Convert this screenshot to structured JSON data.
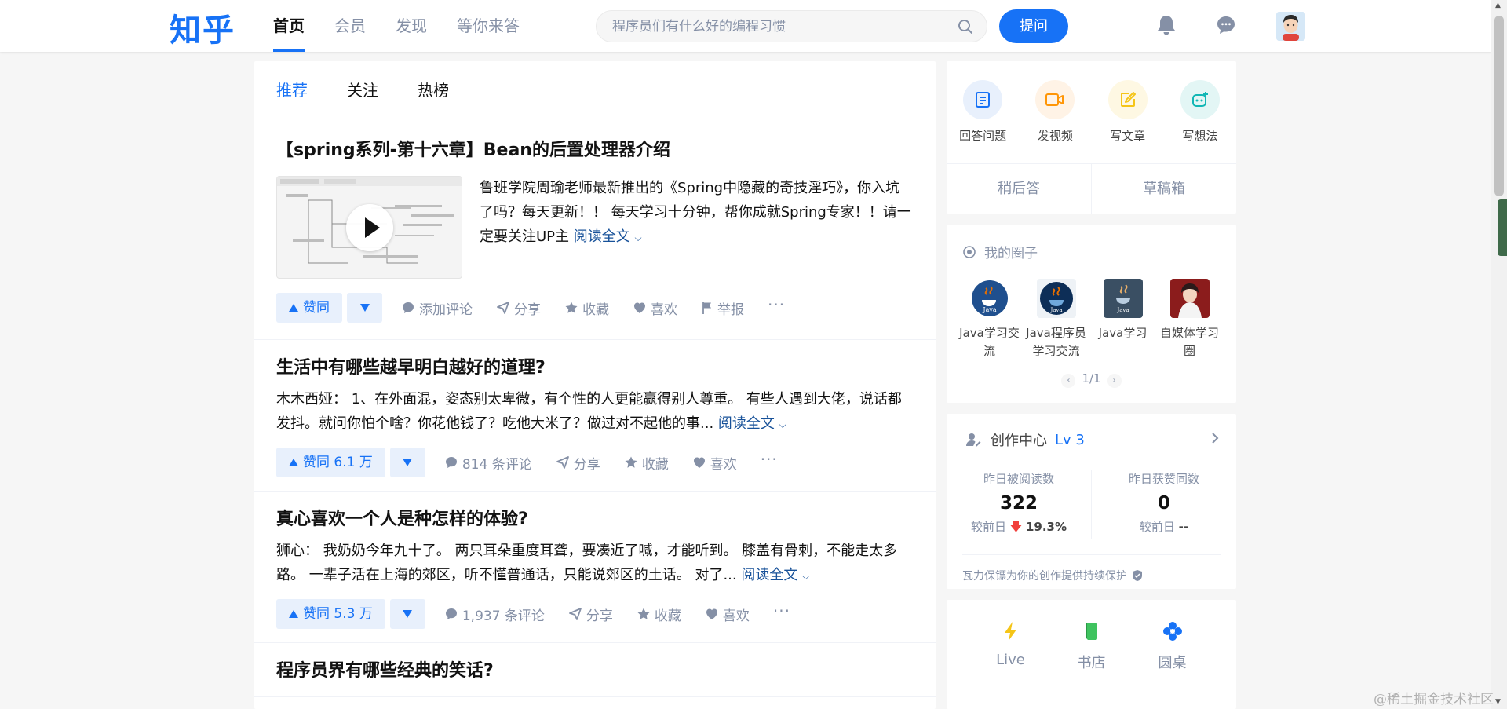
{
  "header": {
    "logo": "知乎",
    "nav": [
      {
        "label": "首页",
        "active": true
      },
      {
        "label": "会员",
        "active": false
      },
      {
        "label": "发现",
        "active": false
      },
      {
        "label": "等你来答",
        "active": false
      }
    ],
    "search_placeholder": "程序员们有什么好的编程习惯",
    "ask_label": "提问"
  },
  "feed": {
    "tabs": [
      {
        "label": "推荐",
        "active": true
      },
      {
        "label": "关注",
        "active": false
      },
      {
        "label": "热榜",
        "active": false
      }
    ],
    "cards": [
      {
        "title": "【spring系列-第十六章】Bean的后置处理器介绍",
        "excerpt": "鲁班学院周瑜老师最新推出的《Spring中隐藏的奇技淫巧》，你入坑了吗？每天更新！！ 每天学习十分钟，帮你成就Spring专家！！请一定要关注UP主",
        "read_more": "阅读全文",
        "vote_label": "赞同",
        "comments": "添加评论",
        "share": "分享",
        "collect": "收藏",
        "like": "喜欢",
        "report": "举报",
        "more": "···"
      },
      {
        "title": "生活中有哪些越早明白越好的道理?",
        "excerpt": "木木西娅： 1、在外面混，姿态别太卑微，有个性的人更能赢得别人尊重。 有些人遇到大佬，说话都发抖。就问你怕个啥？你花他钱了？吃他大米了？做过对不起他的事...",
        "read_more": "阅读全文",
        "vote_label": "赞同 6.1 万",
        "comments": "814 条评论",
        "share": "分享",
        "collect": "收藏",
        "like": "喜欢",
        "more": "···"
      },
      {
        "title": "真心喜欢一个人是种怎样的体验?",
        "excerpt": "狮心： 我奶奶今年九十了。 两只耳朵重度耳聋，要凑近了喊，才能听到。 膝盖有骨刺，不能走太多路。 一辈子活在上海的郊区，听不懂普通话，只能说郊区的土话。 对了...",
        "read_more": "阅读全文",
        "vote_label": "赞同 5.3 万",
        "comments": "1,937 条评论",
        "share": "分享",
        "collect": "收藏",
        "like": "喜欢",
        "more": "···"
      },
      {
        "title": "程序员界有哪些经典的笑话?"
      }
    ]
  },
  "sidebar": {
    "quick": [
      {
        "label": "回答问题",
        "icon": "answer-icon",
        "color": "#1772f6",
        "bg": "#e8f0fc"
      },
      {
        "label": "发视频",
        "icon": "video-icon",
        "color": "#ff9607",
        "bg": "#fff3e6"
      },
      {
        "label": "写文章",
        "icon": "article-icon",
        "color": "#f5c518",
        "bg": "#fef8e3"
      },
      {
        "label": "写想法",
        "icon": "idea-icon",
        "color": "#12b7b5",
        "bg": "#e3f6f5"
      }
    ],
    "later": "稍后答",
    "drafts": "草稿箱",
    "circles_title": "我的圈子",
    "circles": [
      {
        "name": "Java学习交流"
      },
      {
        "name": "Java程序员学习交流"
      },
      {
        "name": "Java学习"
      },
      {
        "name": "自媒体学习圈"
      }
    ],
    "circles_page": "1/1",
    "creation": {
      "title": "创作中心",
      "level": "Lv 3",
      "stats": [
        {
          "label": "昨日被阅读数",
          "value": "322",
          "compare_prefix": "较前日",
          "compare_value": "19.3%"
        },
        {
          "label": "昨日获赞同数",
          "value": "0",
          "compare_prefix": "较前日",
          "compare_value": "--"
        }
      ],
      "protect": "瓦力保镖为你的创作提供持续保护"
    },
    "tools": [
      {
        "label": "Live",
        "icon": "lightning-icon",
        "color": "#f5c518"
      },
      {
        "label": "书店",
        "icon": "book-icon",
        "color": "#3fc35f"
      },
      {
        "label": "圆桌",
        "icon": "roundtable-icon",
        "color": "#1772f6"
      }
    ]
  },
  "watermark": "@稀土掘金技术社区"
}
